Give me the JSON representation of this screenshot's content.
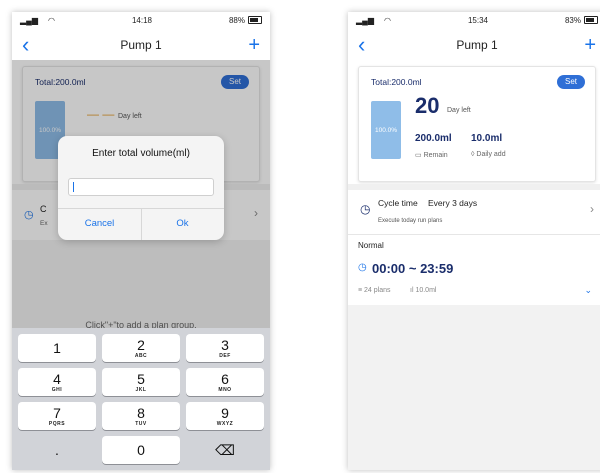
{
  "left": {
    "status": {
      "time": "14:18",
      "battery": "88%"
    },
    "title": "Pump 1",
    "card": {
      "total": "Total:200.0ml",
      "set": "Set",
      "tank_pct": "100.0%",
      "dash": "— —",
      "day_left": "Day left"
    },
    "cycle": {
      "letter": "C",
      "sub": "Ex"
    },
    "hint": "Click\"+\"to add a plan group.",
    "dialog": {
      "title": "Enter total volume(ml)",
      "cancel": "Cancel",
      "ok": "Ok"
    },
    "keys": [
      {
        "num": "1",
        "letters": ""
      },
      {
        "num": "2",
        "letters": "ABC"
      },
      {
        "num": "3",
        "letters": "DEF"
      },
      {
        "num": "4",
        "letters": "GHI"
      },
      {
        "num": "5",
        "letters": "JKL"
      },
      {
        "num": "6",
        "letters": "MNO"
      },
      {
        "num": "7",
        "letters": "PQRS"
      },
      {
        "num": "8",
        "letters": "TUV"
      },
      {
        "num": "9",
        "letters": "WXYZ"
      },
      {
        "num": ".",
        "letters": ""
      },
      {
        "num": "0",
        "letters": ""
      },
      {
        "num": "⌫",
        "letters": ""
      }
    ]
  },
  "right": {
    "status": {
      "time": "15:34",
      "battery": "83%"
    },
    "title": "Pump 1",
    "card": {
      "total": "Total:200.0ml",
      "set": "Set",
      "tank_pct": "100.0%",
      "days": "20",
      "day_left": "Day left",
      "remain_value": "200.0ml",
      "remain_label": "Remain",
      "daily_value": "10.0ml",
      "daily_label": "Daily add"
    },
    "cycle": {
      "label": "Cycle time",
      "value": "Every 3 days",
      "sub": "Execute today run plans"
    },
    "plan": {
      "mode": "Normal",
      "time_range": "00:00 ~ 23:59",
      "plans": "24 plans",
      "amount": "10.0ml"
    }
  },
  "colors": {
    "accent": "#1a73e8",
    "set_button": "#2f6fd6",
    "tank": "#8fbde8",
    "title_dark": "#1a2d6b"
  },
  "icons": [
    "back-arrow-icon",
    "plus-icon",
    "clock-icon",
    "chevron-right-icon",
    "chevron-down-icon",
    "box-icon",
    "drop-icon",
    "list-icon",
    "bar-icon",
    "backspace-icon"
  ]
}
